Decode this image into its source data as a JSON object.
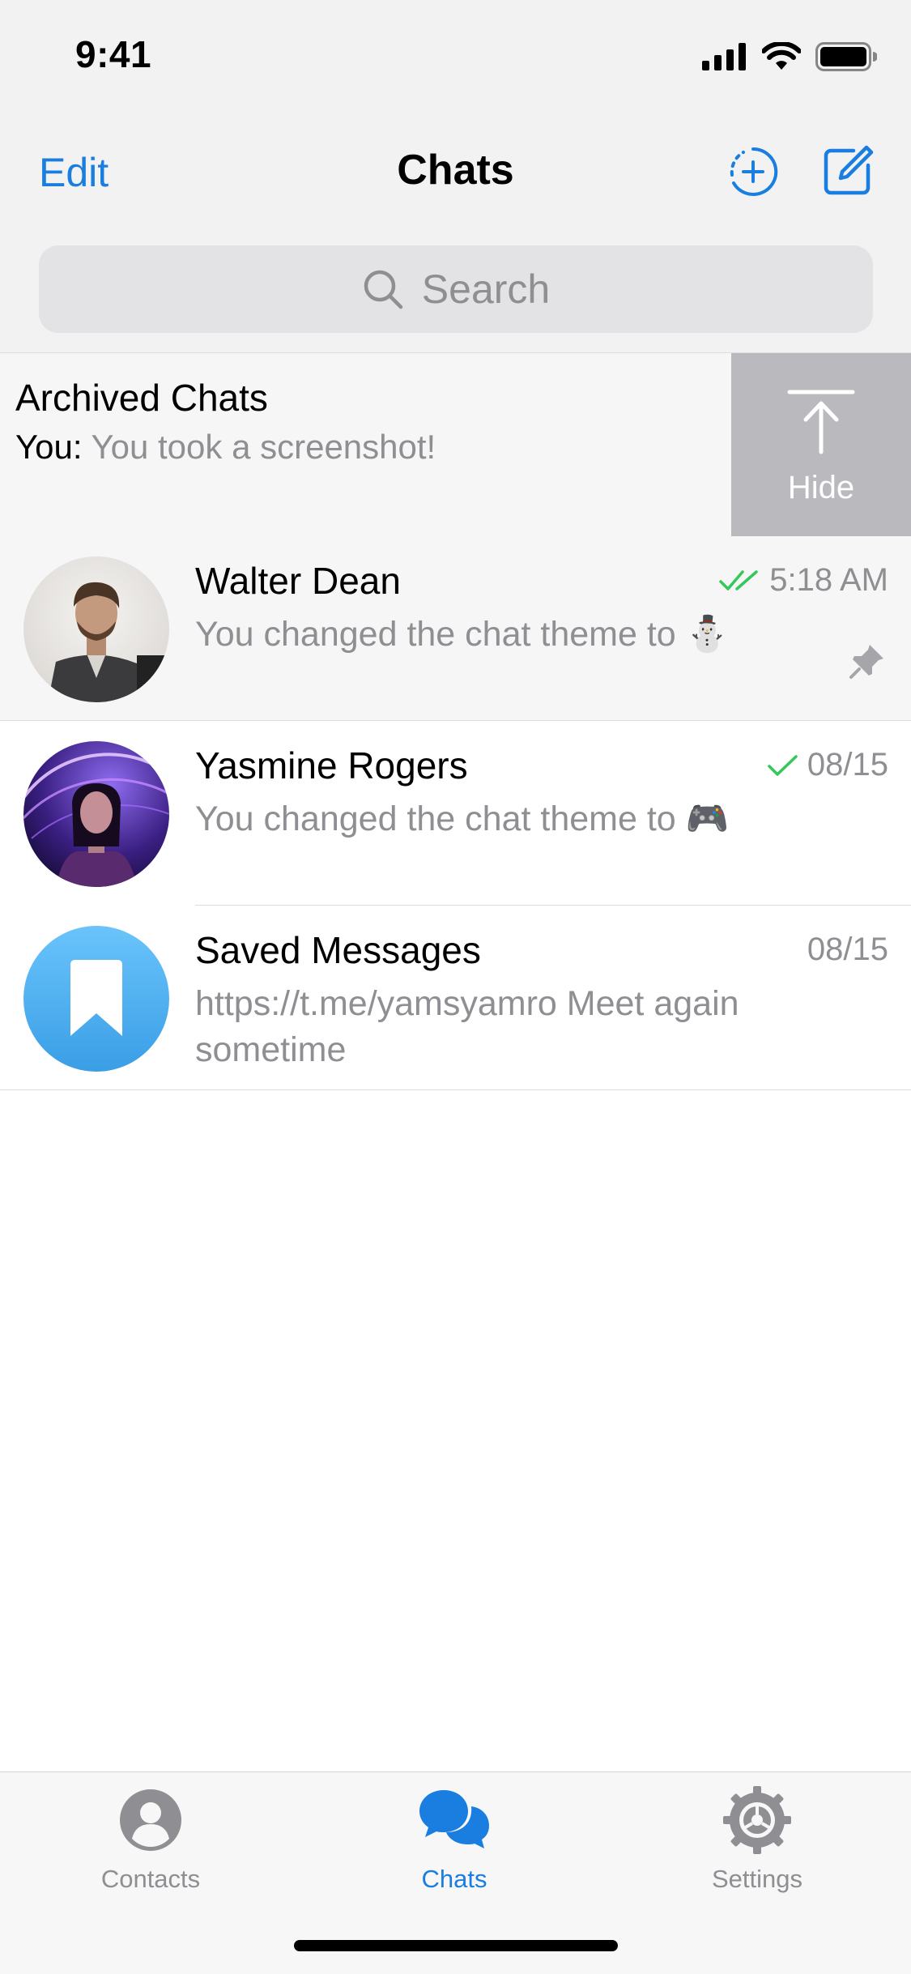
{
  "status_bar": {
    "time": "9:41"
  },
  "nav": {
    "edit_label": "Edit",
    "title": "Chats"
  },
  "search": {
    "placeholder": "Search"
  },
  "archived": {
    "title": "Archived Chats",
    "sender": "You:",
    "preview": "You took a screenshot!",
    "hide_label": "Hide"
  },
  "chats": [
    {
      "name": "Walter Dean",
      "time": "5:18 AM",
      "preview": "You changed the chat theme to ⛄",
      "status": "read",
      "pinned": true
    },
    {
      "name": "Yasmine Rogers",
      "time": "08/15",
      "preview": "You changed the chat theme to 🎮",
      "status": "sent",
      "pinned": false
    },
    {
      "name": "Saved Messages",
      "time": "08/15",
      "preview": "https://t.me/yamsyamro Meet again sometime",
      "status": "none",
      "pinned": false
    }
  ],
  "tabs": [
    {
      "label": "Contacts",
      "icon": "person-icon",
      "active": false
    },
    {
      "label": "Chats",
      "icon": "chat-bubbles-icon",
      "active": true
    },
    {
      "label": "Settings",
      "icon": "gear-icon",
      "active": false
    }
  ],
  "colors": {
    "accent": "#1a7ee0",
    "check_green": "#34c759",
    "secondary_text": "#8e8e93",
    "hide_action_bg": "#b9b9be"
  }
}
